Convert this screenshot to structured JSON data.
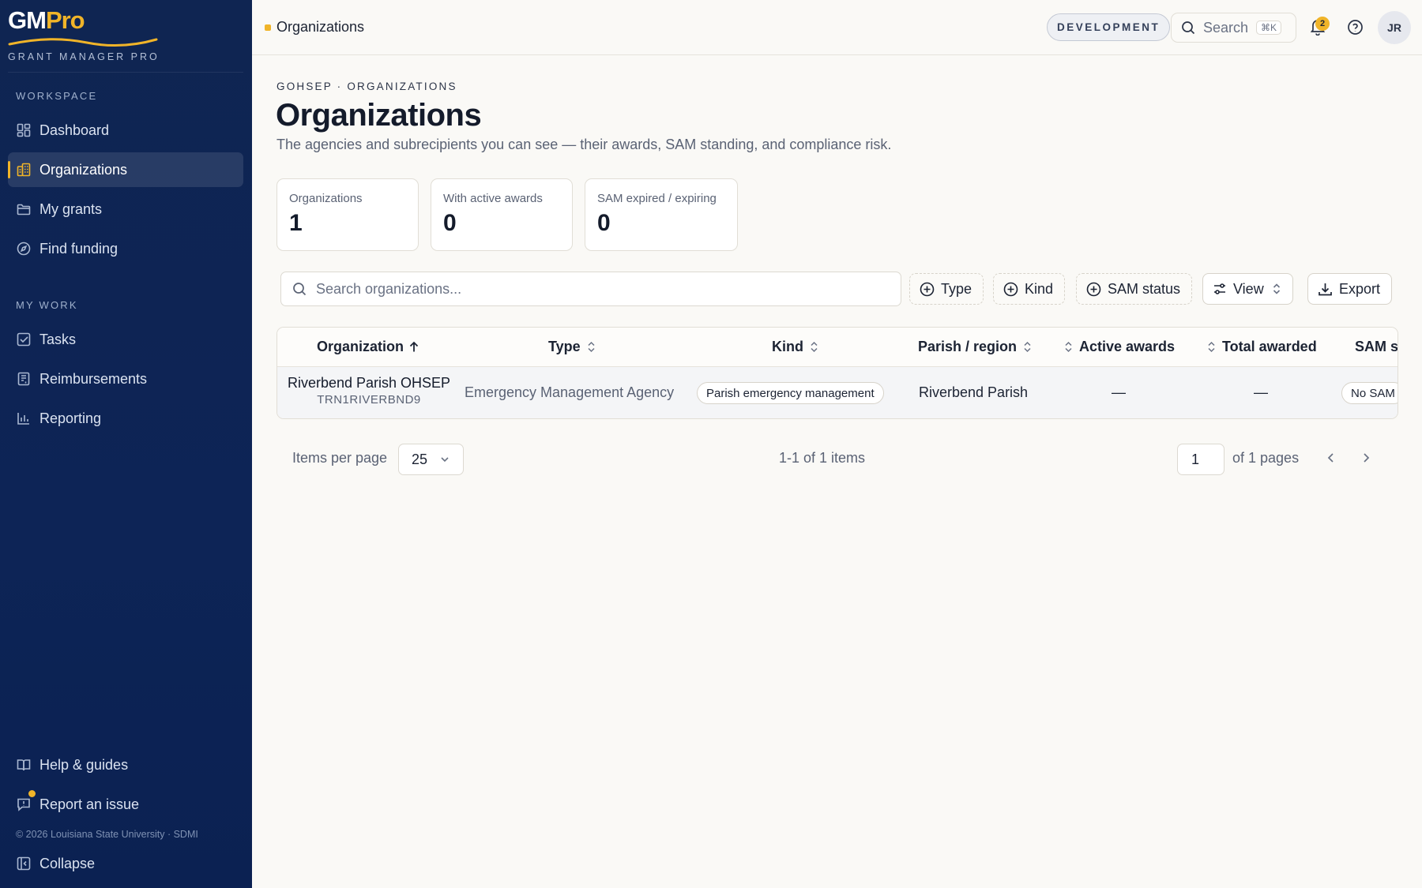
{
  "brand": {
    "logo_gm": "GM",
    "logo_pro": "Pro",
    "tagline": "GRANT MANAGER PRO"
  },
  "sidebar": {
    "workspace_label": "WORKSPACE",
    "workspace_items": [
      {
        "label": "Dashboard",
        "icon": "dashboard-icon"
      },
      {
        "label": "Organizations",
        "icon": "building-icon",
        "active": true
      },
      {
        "label": "My grants",
        "icon": "folder-icon"
      },
      {
        "label": "Find funding",
        "icon": "compass-icon"
      }
    ],
    "mywork_label": "MY WORK",
    "mywork_items": [
      {
        "label": "Tasks",
        "icon": "checkbox-icon"
      },
      {
        "label": "Reimbursements",
        "icon": "receipt-icon"
      },
      {
        "label": "Reporting",
        "icon": "bar-chart-icon"
      }
    ],
    "footer_items": [
      {
        "label": "Help & guides",
        "icon": "book-icon"
      },
      {
        "label": "Report an issue",
        "icon": "message-alert-icon"
      },
      {
        "label": "Collapse",
        "icon": "collapse-panel-icon"
      }
    ],
    "copyright": "© 2026 Louisiana State University · SDMI"
  },
  "topbar": {
    "breadcrumb": "Organizations",
    "env_badge": "DEVELOPMENT",
    "search_label": "Search",
    "search_shortcut": "⌘K",
    "notification_count": "2",
    "avatar_initials": "JR"
  },
  "page": {
    "eyebrow": "GOHSEP · ORGANIZATIONS",
    "title": "Organizations",
    "subtitle": "The agencies and subrecipients you can see — their awards, SAM standing, and compliance risk."
  },
  "stats": [
    {
      "label": "Organizations",
      "value": "1"
    },
    {
      "label": "With active awards",
      "value": "0"
    },
    {
      "label": "SAM expired / expiring",
      "value": "0"
    }
  ],
  "filters": {
    "search_placeholder": "Search organizations...",
    "type": "Type",
    "kind": "Kind",
    "sam_status": "SAM status",
    "view": "View",
    "export": "Export"
  },
  "table": {
    "columns": {
      "organization": "Organization",
      "type": "Type",
      "kind": "Kind",
      "parish": "Parish / region",
      "active_awards": "Active awards",
      "total_awarded": "Total awarded",
      "sam": "SAM s"
    },
    "rows": [
      {
        "name": "Riverbend Parish OHSEP",
        "code": "TRN1RIVERBND9",
        "type": "Emergency Management Agency",
        "kind": "Parish emergency management",
        "parish": "Riverbend Parish",
        "active_awards": "—",
        "total_awarded": "—",
        "sam": "No SAM"
      }
    ]
  },
  "pagination": {
    "items_per_page_label": "Items per page",
    "items_per_page": "25",
    "range": "1-1 of 1 items",
    "current_page": "1",
    "of_pages": "of 1 pages"
  }
}
